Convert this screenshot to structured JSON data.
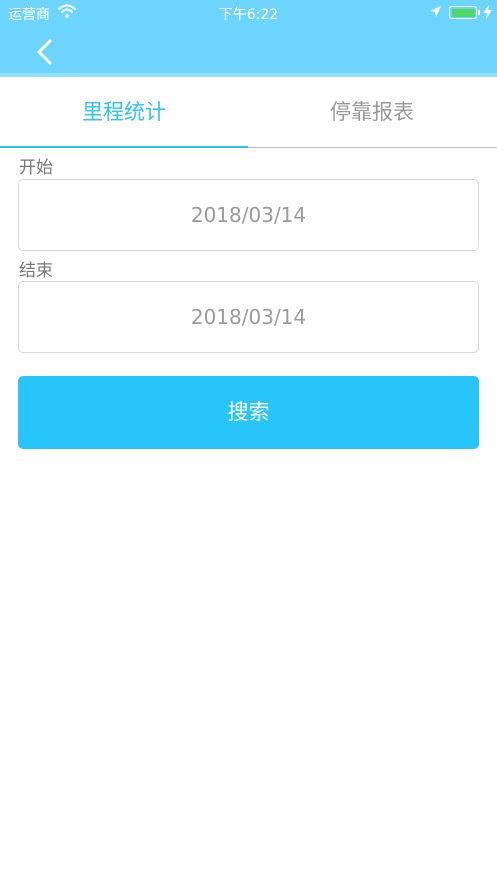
{
  "status_bar": {
    "carrier": "运营商",
    "time": "下午6:22",
    "battery_level": 1.0
  },
  "nav": {
    "back_icon": "chevron-left-icon"
  },
  "tabs": [
    {
      "label": "里程统计",
      "active": true
    },
    {
      "label": "停靠报表",
      "active": false
    }
  ],
  "form": {
    "start_label": "开始",
    "start_value": "2018/03/14",
    "end_label": "结束",
    "end_value": "2018/03/14",
    "search_label": "搜索"
  },
  "colors": {
    "header_bg": "#6dd5fd",
    "accent": "#2ec3f7",
    "button_bg": "#28c5fb",
    "battery": "#4cd964"
  }
}
